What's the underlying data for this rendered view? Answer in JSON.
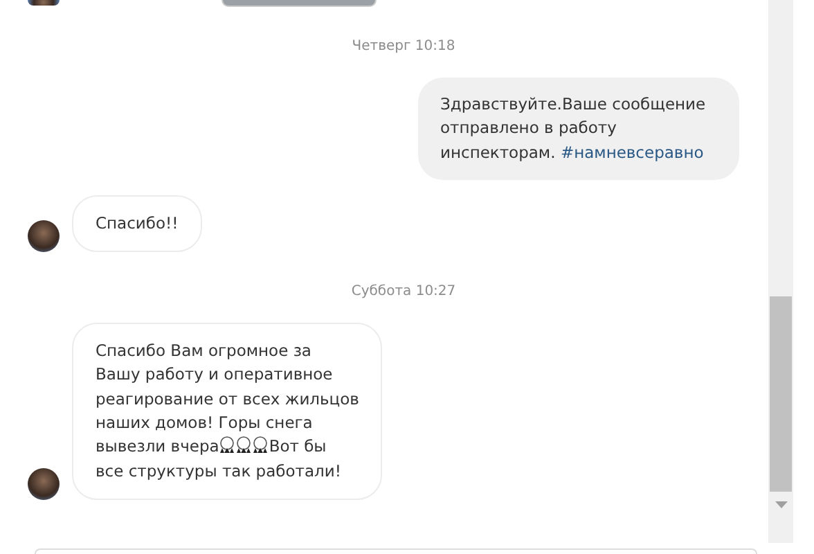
{
  "messages": [
    {
      "kind": "photo",
      "outgoing": false
    },
    {
      "kind": "date",
      "text": "Четверг 10:18"
    },
    {
      "kind": "text",
      "outgoing": true,
      "lines": [
        [
          {
            "kind": "text",
            "text": "Здравствуйте.Ваше сообщение"
          }
        ],
        [
          {
            "kind": "text",
            "text": "отправлено в работу"
          }
        ],
        [
          {
            "kind": "text",
            "text": "инспекторам. "
          },
          {
            "kind": "hashtag",
            "text": "#намневсеравно"
          }
        ]
      ]
    },
    {
      "kind": "text",
      "outgoing": false,
      "lines": [
        [
          {
            "kind": "text",
            "text": "Спасибо!!"
          }
        ]
      ]
    },
    {
      "kind": "date",
      "text": "Суббота 10:27"
    },
    {
      "kind": "text",
      "outgoing": false,
      "lines": [
        [
          {
            "kind": "text",
            "text": "Спасибо Вам огромное за"
          }
        ],
        [
          {
            "kind": "text",
            "text": "Вашу работу и оперативное"
          }
        ],
        [
          {
            "kind": "text",
            "text": "реагирование от всех жильцов"
          }
        ],
        [
          {
            "kind": "text",
            "text": "наших домов! Горы снега"
          }
        ],
        [
          {
            "kind": "text",
            "text": "вывезли вчера"
          },
          {
            "kind": "emoji"
          },
          {
            "kind": "emoji"
          },
          {
            "kind": "emoji"
          },
          {
            "kind": "text",
            "text": "Вот бы"
          }
        ],
        [
          {
            "kind": "text",
            "text": "все структуры так работали!"
          }
        ]
      ]
    }
  ]
}
